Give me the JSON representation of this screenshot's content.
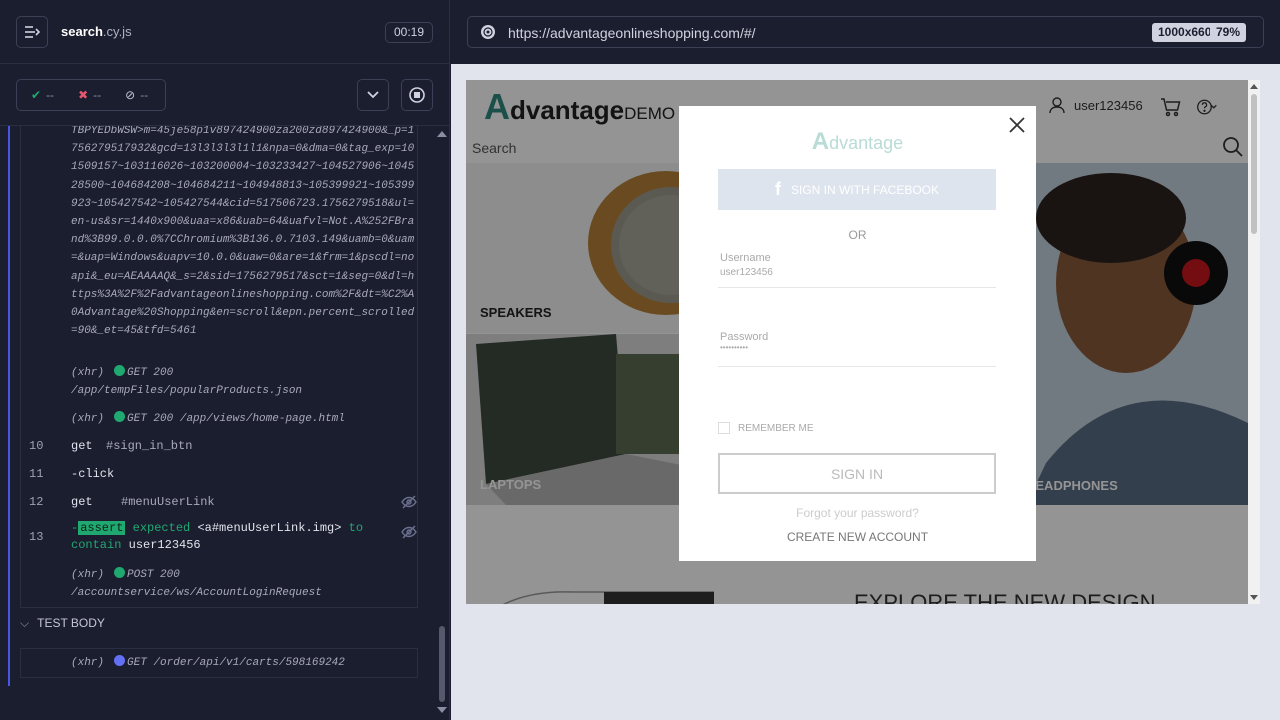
{
  "runner": {
    "spec_file_name": "search",
    "spec_file_ext": ".cy.js",
    "timer": "00:19",
    "stats": {
      "passed": "--",
      "failed": "--",
      "skipped": "--"
    },
    "request_blob": "TBPYEDbWSW>m=45je58p1v897424900za200zd897424900&_p=1756279517932&gcd=13l3l3l3l1l1&npa=0&dma=0&tag_exp=101509157~103116026~103200004~103233427~104527906~104528500~104684208~104684211~104948813~105399921~105399923~105427542~105427544&cid=517506723.1756279518&ul=en-us&sr=1440x900&uaa=x86&uab=64&uafvl=Not.A%252FBrand%3B99.0.0.0%7CChromium%3B136.0.7103.149&uamb=0&uam=&uap=Windows&uapv=10.0.0&uaw=0&are=1&frm=1&pscdl=noapi&_eu=AEAAAAQ&_s=2&sid=1756279517&sct=1&seg=0&dl=https%3A%2F%2Fadvantageonlineshopping.com%2F&dt=%C2%A0Advantage%20Shopping&en=scroll&epn.percent_scrolled=90&_et=45&tfd=5461",
    "xhr1": {
      "label": "(xhr)",
      "method": "GET 200",
      "path": "/app/tempFiles/popularProducts.json"
    },
    "xhr2": {
      "label": "(xhr)",
      "method": "GET 200",
      "path": "/app/views/home-page.html"
    },
    "commands": [
      {
        "num": "10",
        "name": "get",
        "arg": "#sign_in_btn"
      },
      {
        "num": "11",
        "name": "-click",
        "arg": ""
      },
      {
        "num": "12",
        "name": "get",
        "arg": "#menuUserLink"
      }
    ],
    "assert": {
      "num": "13",
      "dash": "-",
      "tag": "assert",
      "expected": "expected",
      "subject": "<a#menuUserLink.img>",
      "to": "to",
      "contain": "contain",
      "value": "user123456"
    },
    "xhr3": {
      "label": "(xhr)",
      "method": "POST 200",
      "path": "/accountservice/ws/AccountLoginRequest"
    },
    "test_body_label": "TEST BODY",
    "xhr4": {
      "label": "(xhr)",
      "method": "GET",
      "path": "/order/api/v1/carts/598169242"
    }
  },
  "browser": {
    "url": "https://advantageonlineshopping.com/#/",
    "viewport": "1000x660",
    "zoom": "79%"
  },
  "site": {
    "logo_a": "A",
    "logo_rest": "dvantage",
    "logo_demo": "DEMO",
    "username": "user123456",
    "search_label": "Search",
    "tiles": {
      "speakers": "SPEAKERS",
      "laptops": "LAPTOPS",
      "headphones": "HEADPHONES"
    },
    "explore": "EXPLORE THE NEW DESIGN"
  },
  "modal": {
    "logo_a": "A",
    "logo_rest": "dvantage",
    "facebook_btn": "SIGN IN WITH FACEBOOK",
    "or": "OR",
    "username_label": "Username",
    "username_value": "user123456",
    "password_label": "Password",
    "password_value": "••••••••••",
    "remember_me": "REMEMBER ME",
    "sign_in": "SIGN IN",
    "forgot": "Forgot your password?",
    "create": "CREATE NEW ACCOUNT"
  }
}
